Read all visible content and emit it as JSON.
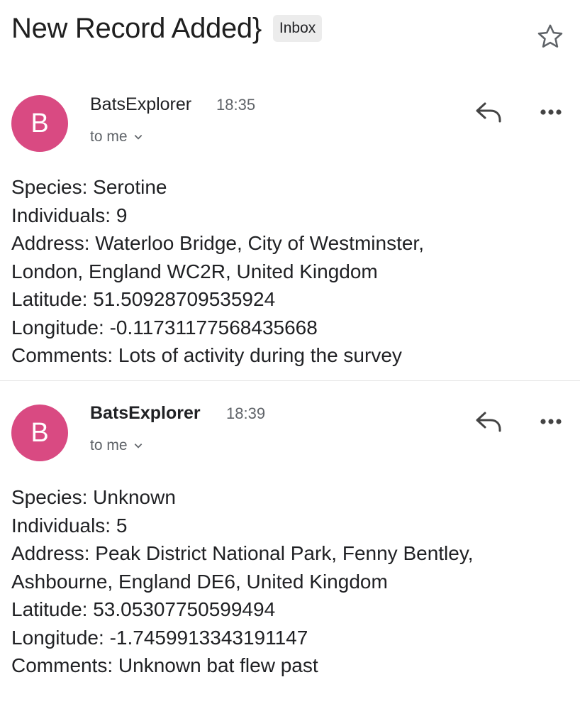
{
  "subject": "New Record Added}",
  "label": "Inbox",
  "messages": [
    {
      "avatar_letter": "B",
      "sender": "BatsExplorer",
      "time": "18:35",
      "recipient": "to me",
      "body": [
        "Species: Serotine",
        "Individuals: 9",
        "Address: Waterloo Bridge, City of Westminster,",
        "London, England WC2R, United Kingdom",
        "Latitude: 51.50928709535924",
        "Longitude: -0.11731177568435668",
        "Comments: Lots of activity during the survey"
      ]
    },
    {
      "avatar_letter": "B",
      "sender": "BatsExplorer",
      "time": "18:39",
      "recipient": "to me",
      "body": [
        "Species: Unknown",
        "Individuals: 5",
        "Address: Peak District National Park, Fenny Bentley,",
        "Ashbourne, England DE6, United Kingdom",
        "Latitude: 53.05307750599494",
        "Longitude: -1.7459913343191147",
        "Comments: Unknown bat flew past"
      ]
    }
  ],
  "colors": {
    "avatar": "#d94a82",
    "label_bg": "#ececec",
    "secondary_text": "#5f6368"
  },
  "icons": [
    "star-icon",
    "reply-icon",
    "more-options-icon",
    "chevron-down-icon"
  ]
}
